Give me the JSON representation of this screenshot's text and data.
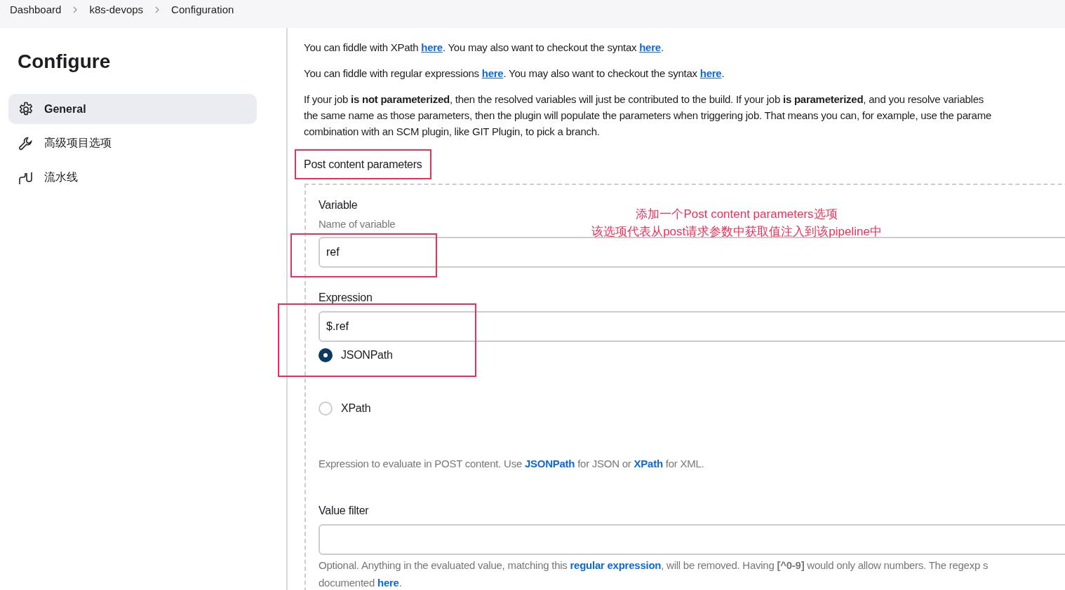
{
  "breadcrumb": [
    "Dashboard",
    "k8s-devops",
    "Configuration"
  ],
  "sidebar": {
    "title": "Configure",
    "items": [
      {
        "label": "General",
        "selected": true
      },
      {
        "label": "高级项目选项",
        "selected": false
      },
      {
        "label": "流水线",
        "selected": false
      }
    ]
  },
  "help_paragraphs": [
    {
      "lines": [
        [
          "You can fiddle with XPath ",
          "here",
          ". You may also want to checkout the syntax ",
          "here",
          "."
        ]
      ]
    },
    {
      "lines": [
        [
          "You can fiddle with regular expressions ",
          "here",
          ". You may also want to checkout the syntax ",
          "here",
          "."
        ]
      ]
    },
    {
      "lines": [
        [
          "If your job **is not parameterized**, then the resolved variables will just be contributed to the build. If your job **is parameterized**, and you resolve variables"
        ],
        [
          "the same name as those parameters, then the plugin will populate the parameters when triggering job. That means you can, for example, use the parame"
        ],
        [
          "combination with an SCM plugin, like GIT Plugin, to pick a branch."
        ]
      ]
    }
  ],
  "section_title": "Post content parameters",
  "variable": {
    "label": "Variable",
    "hint": "Name of variable",
    "value": "ref"
  },
  "expression": {
    "label": "Expression",
    "value": "$.ref",
    "options": [
      {
        "label": "JSONPath",
        "selected": true
      },
      {
        "label": "XPath",
        "selected": false
      }
    ],
    "help": [
      "Expression to evaluate in POST content. Use ",
      "JSONPath",
      " for JSON or ",
      "XPath",
      " for XML."
    ]
  },
  "value_filter": {
    "label": "Value filter",
    "help_lines": [
      [
        "Optional. Anything in the evaluated value, matching this ",
        "regular expression",
        ", will be removed. Having **[^0-9]** would only allow numbers. The regexp s"
      ],
      [
        "documented ",
        "here",
        "."
      ]
    ]
  },
  "annotation": [
    "添加一个Post content parameters选项",
    "该选项代表从post请求参数中获取值注入到该pipeline中"
  ]
}
